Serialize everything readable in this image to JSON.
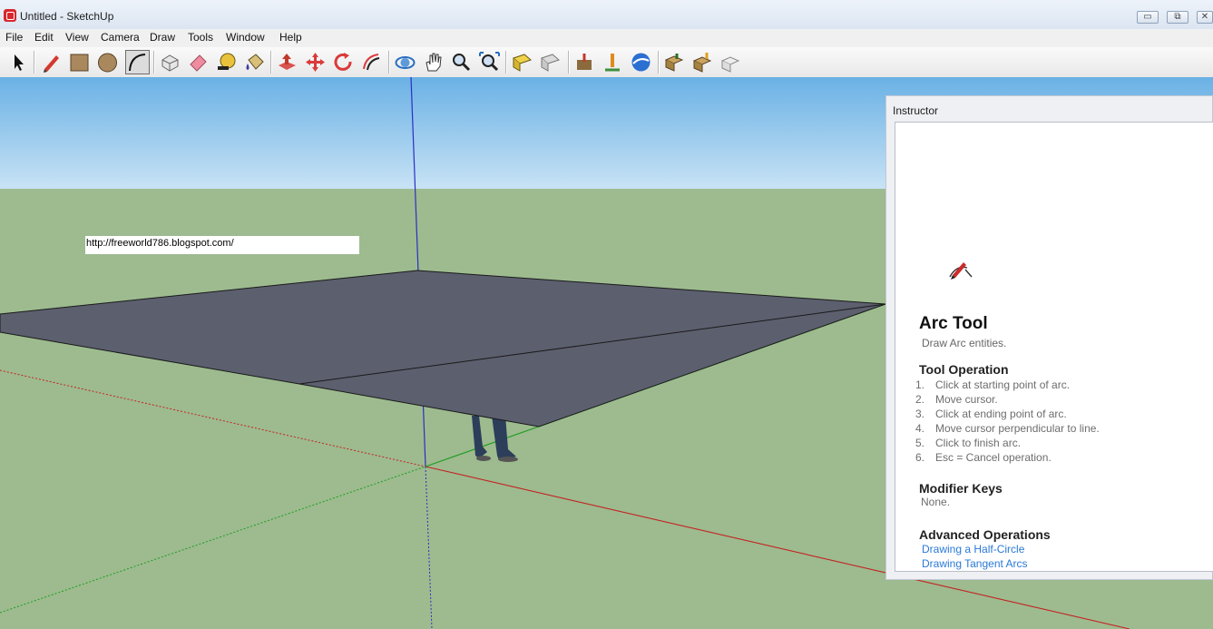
{
  "window": {
    "title": "Untitled - SketchUp",
    "controls": [
      {
        "name": "minimize",
        "glyph": "▭"
      },
      {
        "name": "restore",
        "glyph": "⧉"
      },
      {
        "name": "close",
        "glyph": "✕"
      }
    ]
  },
  "menu": [
    "File",
    "Edit",
    "View",
    "Camera",
    "Draw",
    "Tools",
    "Window",
    "Help"
  ],
  "toolbar": {
    "tools": [
      {
        "name": "select-tool",
        "icon": "arrow-icon"
      },
      {
        "name": "line-tool",
        "icon": "pencil-icon"
      },
      {
        "name": "rectangle-tool",
        "icon": "rectangle-icon"
      },
      {
        "name": "circle-tool",
        "icon": "circle-icon"
      },
      {
        "name": "arc-tool",
        "icon": "arc-icon",
        "active": true
      },
      {
        "name": "make-component-tool",
        "icon": "component-icon"
      },
      {
        "name": "eraser-tool",
        "icon": "eraser-icon"
      },
      {
        "name": "tape-measure-tool",
        "icon": "tape-measure-icon"
      },
      {
        "name": "paint-bucket-tool",
        "icon": "paint-bucket-icon"
      },
      {
        "name": "push-pull-tool",
        "icon": "push-pull-icon"
      },
      {
        "name": "move-tool",
        "icon": "move-icon"
      },
      {
        "name": "rotate-tool",
        "icon": "rotate-icon"
      },
      {
        "name": "offset-tool",
        "icon": "offset-icon"
      },
      {
        "name": "orbit-tool",
        "icon": "orbit-icon"
      },
      {
        "name": "pan-tool",
        "icon": "hand-icon"
      },
      {
        "name": "zoom-tool",
        "icon": "magnifier-icon"
      },
      {
        "name": "zoom-extents-tool",
        "icon": "zoom-extents-icon"
      },
      {
        "name": "previous-view-tool",
        "icon": "previous-view-icon"
      },
      {
        "name": "next-view-tool",
        "icon": "next-view-icon"
      },
      {
        "name": "add-location-tool",
        "icon": "add-location-icon"
      },
      {
        "name": "toggle-terrain-tool",
        "icon": "terrain-icon"
      },
      {
        "name": "preview-in-google-earth-tool",
        "icon": "globe-icon"
      },
      {
        "name": "get-models-tool",
        "icon": "get-models-icon"
      },
      {
        "name": "share-model-tool",
        "icon": "share-model-icon"
      },
      {
        "name": "share-component-tool",
        "icon": "share-component-icon"
      }
    ]
  },
  "viewport": {
    "url_text": "http://freeworld786.blogspot.com/",
    "sky_color": "#7fbde8",
    "ground_color": "#9dbb8f",
    "face_color": "#5c5f6e"
  },
  "instructor": {
    "panel_title": "Instructor",
    "tool_icon": "arc-tool-icon",
    "tool_name": "Arc Tool",
    "tool_description": "Draw Arc entities.",
    "operation_heading": "Tool Operation",
    "steps": [
      {
        "num": "1.",
        "text": "Click at starting point of arc."
      },
      {
        "num": "2.",
        "text": "Move cursor."
      },
      {
        "num": "3.",
        "text": "Click at ending point of arc."
      },
      {
        "num": "4.",
        "text": "Move cursor perpendicular to line."
      },
      {
        "num": "5.",
        "text": "Click to finish arc."
      },
      {
        "num": "6.",
        "text": "Esc = Cancel operation."
      }
    ],
    "modifier_heading": "Modifier Keys",
    "modifier_text": "None.",
    "advanced_heading": "Advanced Operations",
    "advanced_links": [
      "Drawing a Half-Circle",
      "Drawing Tangent Arcs"
    ]
  }
}
